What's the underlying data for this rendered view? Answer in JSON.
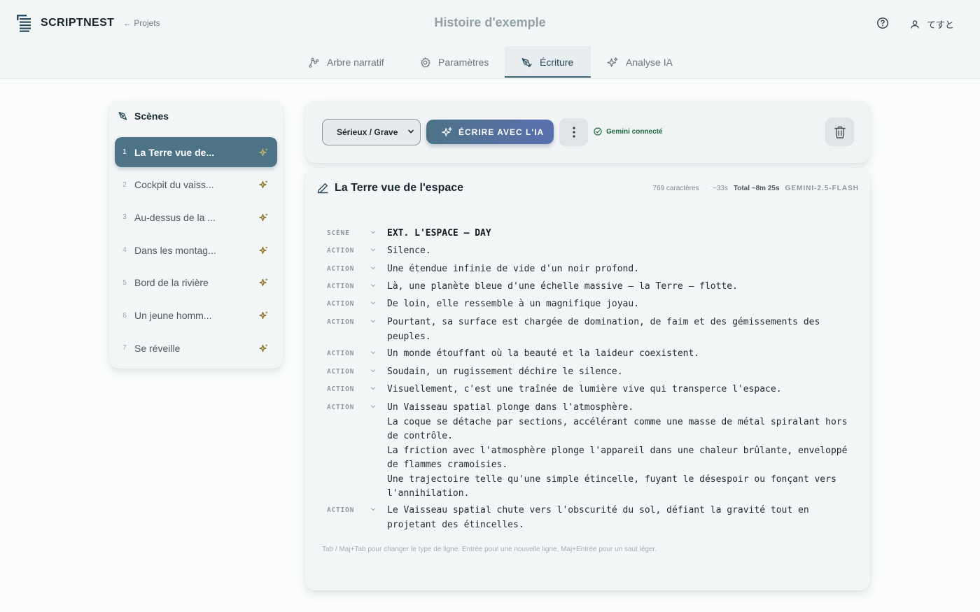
{
  "app": {
    "name": "SCRIPTNEST",
    "back_label": "← Projets",
    "story_title": "Histoire d'exemple",
    "user_name": "てすと"
  },
  "tabs": [
    {
      "label": "Arbre narratif",
      "icon": "tree-icon"
    },
    {
      "label": "Paramètres",
      "icon": "gear-icon"
    },
    {
      "label": "Écriture",
      "icon": "pen-icon",
      "active": true
    },
    {
      "label": "Analyse IA",
      "icon": "sparkles-icon"
    }
  ],
  "scenes": {
    "title": "Scènes",
    "items": [
      {
        "num": "1",
        "label": "La Terre vue de...",
        "active": true
      },
      {
        "num": "2",
        "label": "Cockpit du vaiss..."
      },
      {
        "num": "3",
        "label": "Au-dessus de la ..."
      },
      {
        "num": "4",
        "label": "Dans les montag..."
      },
      {
        "num": "5",
        "label": "Bord de la rivière"
      },
      {
        "num": "6",
        "label": "Un jeune homm..."
      },
      {
        "num": "7",
        "label": "Se réveille"
      }
    ]
  },
  "toolbar": {
    "tone": "Sérieux / Grave",
    "write_label": "ÉCRIRE AVEC L'IA",
    "gemini_status": "Gemini connecté"
  },
  "editor": {
    "title": "La Terre vue de l'espace",
    "chars": "769 caractères",
    "duration": "~33s",
    "total": "Total ~8m 25s",
    "model": "GEMINI-2.5-FLASH",
    "lines": [
      {
        "type": "SCÈNE",
        "text": "EXT. L'ESPACE – DAY"
      },
      {
        "type": "ACTION",
        "text": "Silence."
      },
      {
        "type": "ACTION",
        "text": "Une étendue infinie de vide d'un noir profond."
      },
      {
        "type": "ACTION",
        "text": "Là, une planète bleue d'une échelle massive — la Terre — flotte."
      },
      {
        "type": "ACTION",
        "text": "De loin, elle ressemble à un magnifique joyau."
      },
      {
        "type": "ACTION",
        "text": "Pourtant, sa surface est chargée de domination, de faim et des gémissements des peuples."
      },
      {
        "type": "ACTION",
        "text": "Un monde étouffant où la beauté et la laideur coexistent."
      },
      {
        "type": "ACTION",
        "text": "Soudain, un rugissement déchire le silence."
      },
      {
        "type": "ACTION",
        "text": "Visuellement, c'est une traînée de lumière vive qui transperce l'espace."
      },
      {
        "type": "ACTION",
        "text": "Un Vaisseau spatial plonge dans l'atmosphère.\nLa coque se détache par sections, accélérant comme une masse de métal spiralant hors de contrôle.\nLa friction avec l'atmosphère plonge l'appareil dans une chaleur brûlante, enveloppé de flammes cramoisies.\nUne trajectoire telle qu'une simple étincelle, fuyant le désespoir ou fonçant vers l'annihilation."
      },
      {
        "type": "ACTION",
        "text": "Le Vaisseau spatial chute vers l'obscurité du sol, défiant la gravité tout en projetant des étincelles."
      }
    ],
    "hint": "Tab / Maj+Tab pour changer le type de ligne. Entrée pour une nouvelle ligne, Maj+Entrée pour un saut léger."
  },
  "colors": {
    "accent": "#4d7387",
    "status_green": "#1d6b3c",
    "spark_gold": "#8a6d1e"
  }
}
